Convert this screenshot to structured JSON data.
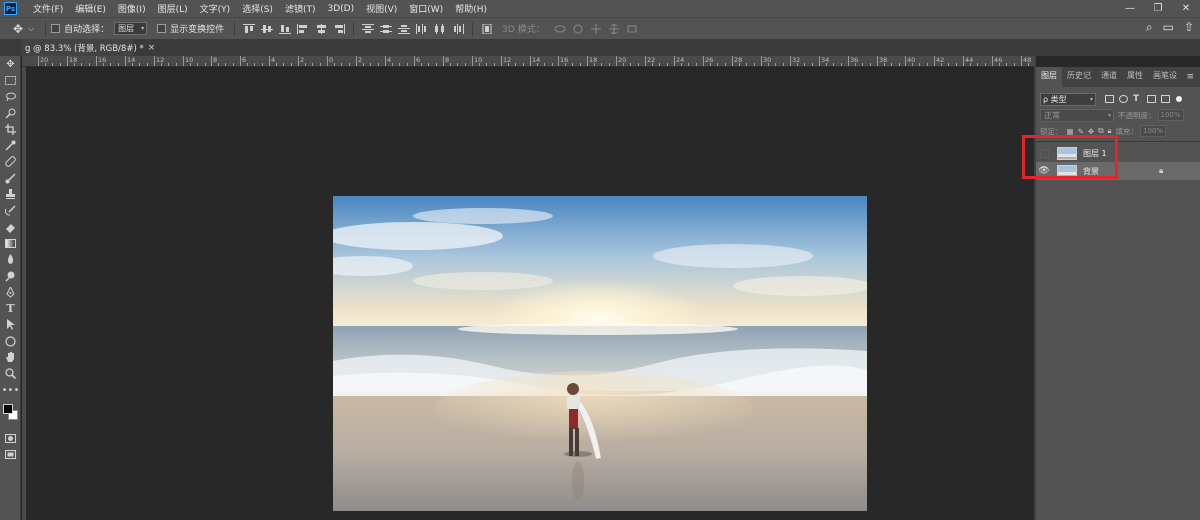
{
  "app": {
    "logo_text": "Ps"
  },
  "menu": [
    "文件(F)",
    "编辑(E)",
    "图像(I)",
    "图层(L)",
    "文字(Y)",
    "选择(S)",
    "滤镜(T)",
    "3D(D)",
    "视图(V)",
    "窗口(W)",
    "帮助(H)"
  ],
  "window_controls": {
    "minimize": "—",
    "maximize": "❐",
    "close": "✕"
  },
  "options": {
    "auto_select_label": "自动选择：",
    "auto_select_value": "图层",
    "show_transform_label": "显示变换控件",
    "mode_3d_label": "3D 模式："
  },
  "document": {
    "tab_title": "g @ 83.3% (背景, RGB/8#) *",
    "close_glyph": "×",
    "toolbar_collapse": "»"
  },
  "ruler": {
    "top_numbers": [
      "20",
      "18",
      "16",
      "14",
      "12",
      "10",
      "8",
      "6",
      "4",
      "2",
      "0",
      "2",
      "4",
      "6",
      "8",
      "10",
      "12",
      "14",
      "16",
      "18",
      "20",
      "22",
      "24",
      "26",
      "28",
      "30",
      "32",
      "34",
      "36",
      "38",
      "40",
      "42",
      "44",
      "46",
      "48"
    ]
  },
  "layers_panel": {
    "tabs": [
      "图层",
      "历史记",
      "通道",
      "属性",
      "画笔设"
    ],
    "active_tab": 0,
    "kind_filter": "ρ 类型",
    "blend_mode": "正常",
    "opacity_label": "不透明度：",
    "opacity_value": "100%",
    "lock_label": "锁定：",
    "fill_label": "填充：",
    "fill_value": "100%",
    "layers": [
      {
        "name": "图层 1",
        "visible": false,
        "selected": false,
        "locked": false
      },
      {
        "name": "背景",
        "visible": true,
        "selected": true,
        "locked": true
      }
    ]
  },
  "colors": {
    "highlight": "#e3262d",
    "accent": "#31a8ff"
  }
}
